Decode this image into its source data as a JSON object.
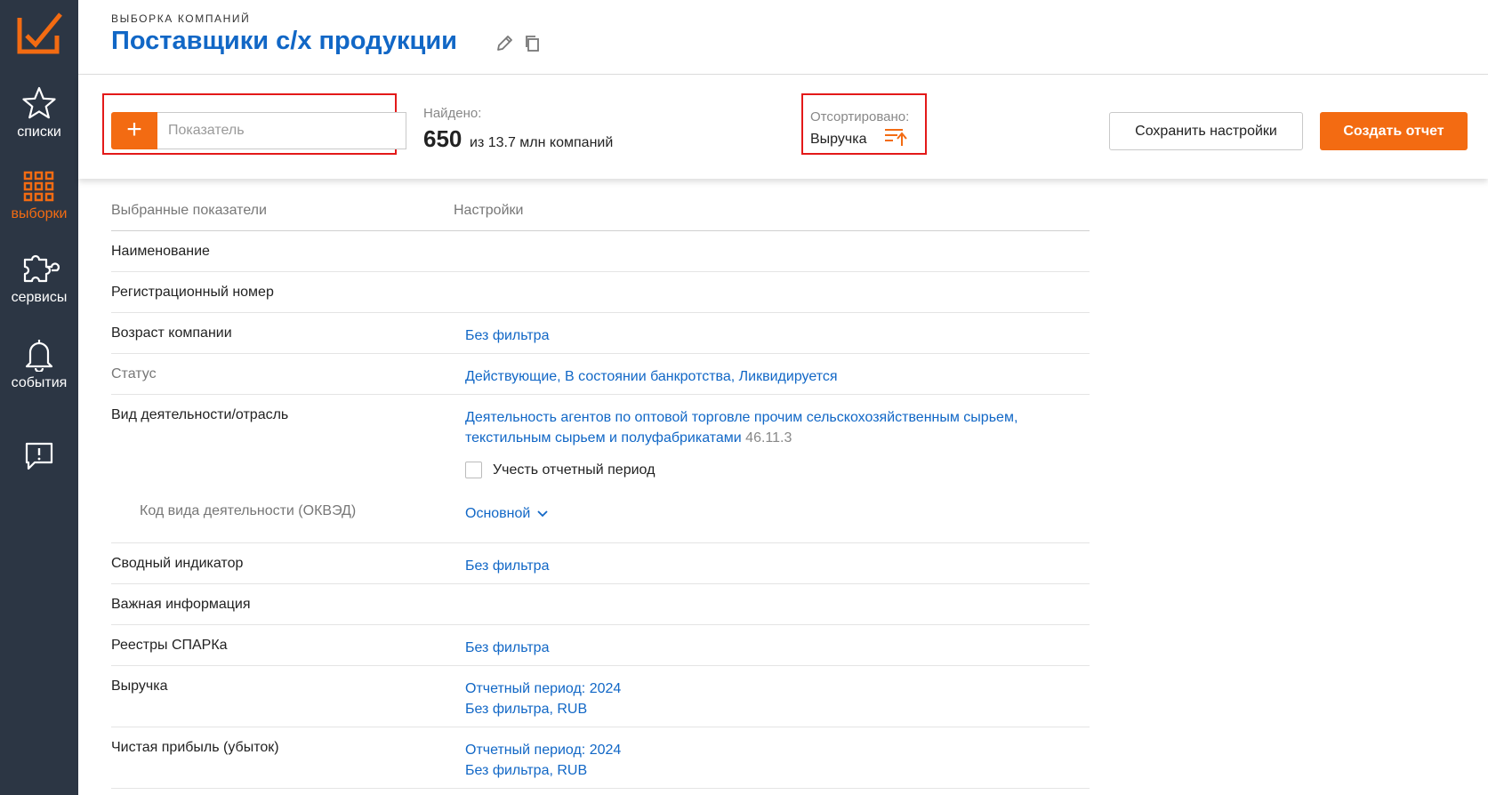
{
  "sidebar": {
    "items": [
      {
        "label": "списки",
        "icon": "star-icon"
      },
      {
        "label": "выборки",
        "icon": "grid-icon"
      },
      {
        "label": "сервисы",
        "icon": "puzzle-icon"
      },
      {
        "label": "события",
        "icon": "bell-icon"
      },
      {
        "label": "",
        "icon": "feedback-icon"
      }
    ]
  },
  "header": {
    "eyebrow": "ВЫБОРКА КОМПАНИЙ",
    "title": "Поставщики с/х продукции"
  },
  "toolbar": {
    "indicator_placeholder": "Показатель",
    "found_label": "Найдено:",
    "found_count": "650",
    "found_text": "из 13.7 млн компаний",
    "sorted_label": "Отсортировано:",
    "sorted_value": "Выручка",
    "save_label": "Сохранить настройки",
    "create_label": "Создать отчет"
  },
  "table": {
    "headers": {
      "indicators": "Выбранные показатели",
      "settings": "Настройки"
    },
    "rows": [
      {
        "name": "Наименование"
      },
      {
        "name": "Регистрационный номер"
      },
      {
        "name": "Возраст компании",
        "setting": "Без фильтра"
      },
      {
        "name": "Статус",
        "setting": "Действующие, В состоянии банкротства, Ликвидируется"
      },
      {
        "name": "Вид деятельности/отрасль",
        "setting_line1": "Деятельность агентов по оптовой торговле прочим сельскохозяйственным сырьем,",
        "setting_line2": "текстильным сырьем и полуфабрикатами",
        "code": "46.11.3",
        "checkbox_label": "Учесть отчетный период"
      },
      {
        "name": "Код вида деятельности (ОКВЭД)",
        "setting": "Основной"
      },
      {
        "name": "Сводный индикатор",
        "setting": "Без фильтра"
      },
      {
        "name": "Важная информация"
      },
      {
        "name": "Реестры СПАРКа",
        "setting": "Без фильтра"
      },
      {
        "name": "Выручка",
        "setting_line1": "Отчетный период: 2024",
        "setting_line2": "Без фильтра, RUB"
      },
      {
        "name": "Чистая прибыль (убыток)",
        "setting_line1": "Отчетный период: 2024",
        "setting_line2": "Без фильтра, RUB"
      }
    ]
  },
  "colors": {
    "accent": "#f36b12",
    "link": "#1167c6",
    "sidebar": "#2c3644",
    "highlight": "#e31919"
  }
}
